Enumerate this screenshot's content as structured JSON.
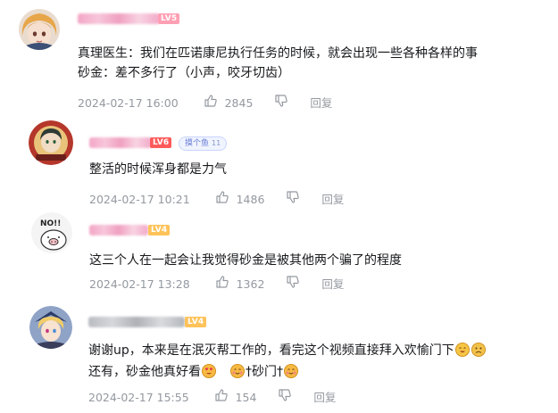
{
  "comments": [
    {
      "level": "LV5",
      "lines": [
        "真理医生：我们在匹诺康尼执行任务的时候，就会出现一些各种各样的事",
        "砂金：差不多行了（小声，咬牙切齿）"
      ],
      "date": "2024-02-17 16:00",
      "likes": "2845",
      "reply": "回复"
    },
    {
      "level": "LV6",
      "fan_badge": "摸个鱼",
      "fan_level": "11",
      "lines": [
        "整活的时候浑身都是力气"
      ],
      "date": "2024-02-17 10:21",
      "likes": "1486",
      "reply": "回复"
    },
    {
      "level": "LV4",
      "avatar_text": "NO!!",
      "lines": [
        "这三个人在一起会让我觉得砂金是被其他两个骗了的程度"
      ],
      "date": "2024-02-17 13:28",
      "likes": "1362",
      "reply": "回复"
    },
    {
      "level": "LV4",
      "lines": [
        "谢谢up，本来是在泯灭帮工作的，看完这个视频直接拜入欢愉门下",
        "还有，砂金他真好看"
      ],
      "line2_tail": "†砂门†",
      "date": "2024-02-17 15:55",
      "likes": "154",
      "reply": "回复"
    }
  ],
  "icons": {
    "like": "thumbs-up-icon",
    "dislike": "thumbs-down-icon"
  },
  "colors": {
    "meta": "#9499a0",
    "text": "#18191c",
    "name_blur": "#f3a6c6"
  }
}
